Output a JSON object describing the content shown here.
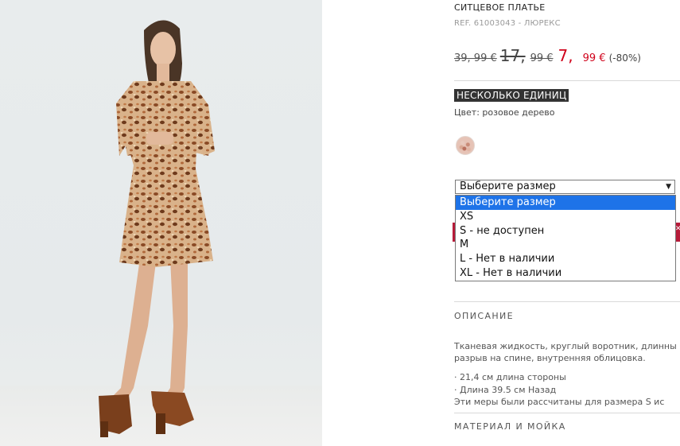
{
  "product": {
    "title": "СИТЦЕВОЕ ПЛАТЬЕ",
    "ref": "REF. 61003043 - ЛЮРЕКС",
    "price_original": "39, 99 €",
    "price_previous_int": "17,",
    "price_previous_cents": "99 €",
    "price_sale_int": "7,",
    "price_sale_cents": "99 €",
    "discount": "(-80%)",
    "stock_badge": "НЕСКОЛЬКО ЕДИНИЦ",
    "color_label": "Цвет: розовое дерево"
  },
  "size_select": {
    "selected": "Выберите размер",
    "options": [
      "Выберите размер",
      "XS",
      "S - не доступен",
      "M",
      "L - Нет в наличии",
      "XL - Нет в наличии"
    ]
  },
  "description": {
    "heading": "ОПИСАНИЕ",
    "line1": "Тканевая жидкость, круглый воротник, длинны",
    "line2": "разрыв на спине, внутренняя облицовка.",
    "meas1": "· 21,4 см длина стороны",
    "meas2": "· Длина 39.5 см Назад",
    "meas3": "Эти меры были рассчитаны для размера S ис"
  },
  "material_heading": "МАТЕРИАЛ И МОЙКА",
  "colors": {
    "sale_red": "#d0021b",
    "highlight_blue": "#1e73e8",
    "badge_bg": "#333333"
  }
}
